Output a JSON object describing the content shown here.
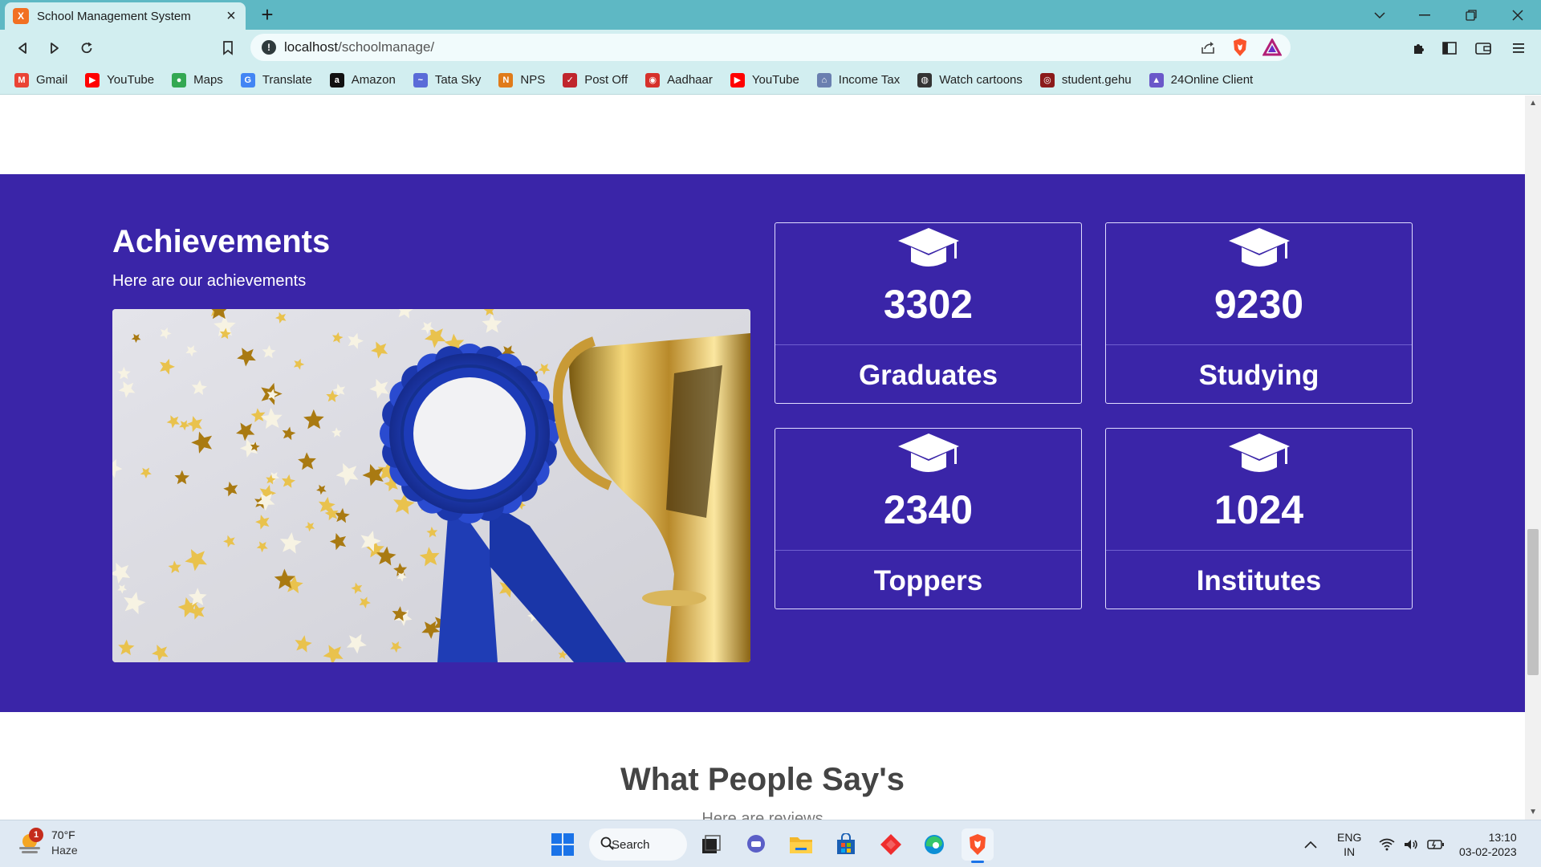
{
  "browser": {
    "tab_title": "School Management System",
    "tab_favicon": "X",
    "url_host": "localhost",
    "url_path": "/schoolmanage/",
    "bookmarks": [
      {
        "label": "Gmail",
        "icon": "gmail-icon",
        "color": "#ea4335",
        "glyph": "M"
      },
      {
        "label": "YouTube",
        "icon": "youtube-icon",
        "color": "#ff0000",
        "glyph": "▶"
      },
      {
        "label": "Maps",
        "icon": "maps-icon",
        "color": "#34a853",
        "glyph": "●"
      },
      {
        "label": "Translate",
        "icon": "translate-icon",
        "color": "#4285f4",
        "glyph": "G"
      },
      {
        "label": "Amazon",
        "icon": "amazon-icon",
        "color": "#111111",
        "glyph": "a"
      },
      {
        "label": "Tata Sky",
        "icon": "tatasky-icon",
        "color": "#5a6bd8",
        "glyph": "~"
      },
      {
        "label": "NPS",
        "icon": "nps-icon",
        "color": "#e07b1a",
        "glyph": "N"
      },
      {
        "label": "Post Off",
        "icon": "postoffice-icon",
        "color": "#c0262d",
        "glyph": "✓"
      },
      {
        "label": "Aadhaar",
        "icon": "aadhaar-icon",
        "color": "#d6312b",
        "glyph": "◉"
      },
      {
        "label": "YouTube",
        "icon": "youtube-icon",
        "color": "#ff0000",
        "glyph": "▶"
      },
      {
        "label": "Income Tax",
        "icon": "incometax-icon",
        "color": "#6a7fb0",
        "glyph": "⌂"
      },
      {
        "label": "Watch cartoons",
        "icon": "globe-icon",
        "color": "#333333",
        "glyph": "◍"
      },
      {
        "label": "student.gehu",
        "icon": "gehu-icon",
        "color": "#8b1a1a",
        "glyph": "◎"
      },
      {
        "label": "24Online Client",
        "icon": "24online-icon",
        "color": "#6b58c9",
        "glyph": "▲"
      }
    ]
  },
  "achievements": {
    "title": "Achievements",
    "subtitle": "Here are our achievements",
    "stats": [
      {
        "number": "3302",
        "label": "Graduates"
      },
      {
        "number": "9230",
        "label": "Studying"
      },
      {
        "number": "2340",
        "label": "Toppers"
      },
      {
        "number": "1024",
        "label": "Institutes"
      }
    ]
  },
  "reviews": {
    "title": "What People Say's",
    "subtitle": "Here are reviews"
  },
  "taskbar": {
    "weather_badge": "1",
    "weather_temp": "70°F",
    "weather_cond": "Haze",
    "search_label": "Search",
    "lang_top": "ENG",
    "lang_bottom": "IN",
    "time": "13:10",
    "date": "03-02-2023"
  },
  "colors": {
    "achievements_bg": "#3a25a8",
    "chrome_bg": "#d2eef0",
    "titlebar_bg": "#5eb8c4"
  }
}
